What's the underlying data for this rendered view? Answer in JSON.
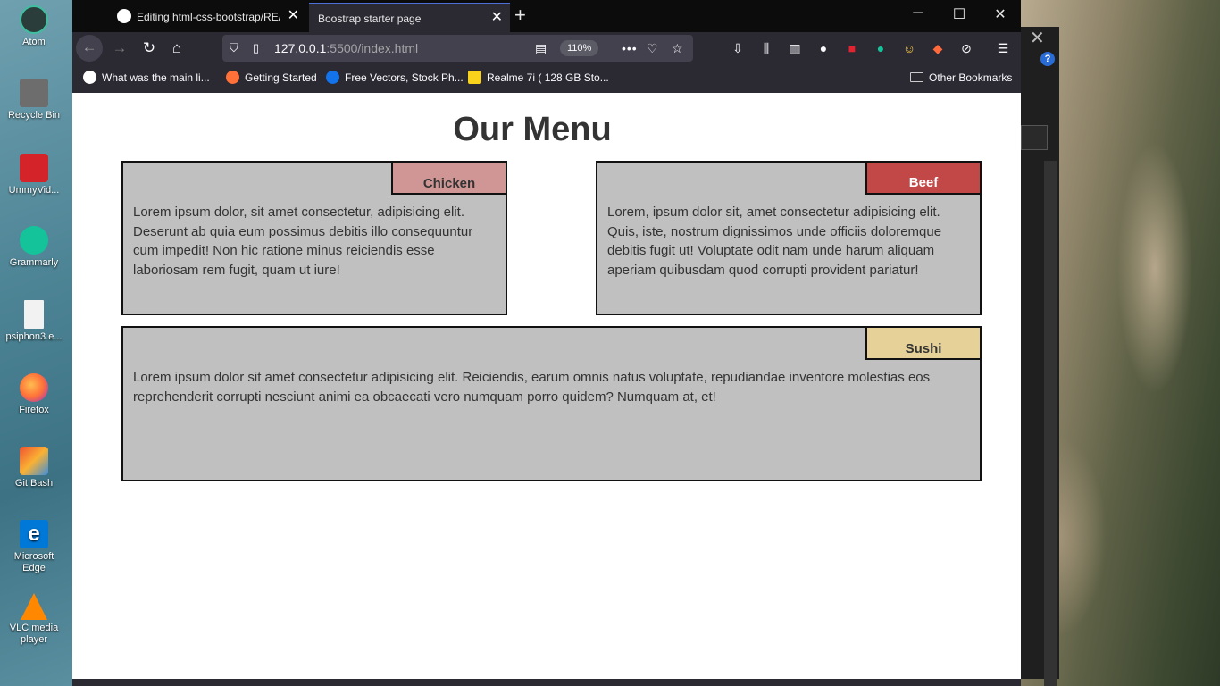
{
  "desktop": {
    "icons": [
      {
        "label": "Atom",
        "color": "#3fbf9f"
      },
      {
        "label": "Recycle Bin",
        "color": "#8a8a8a"
      },
      {
        "label": "UmmyVid...",
        "color": "#d4242a"
      },
      {
        "label": "Grammarly",
        "color": "#15c39a"
      },
      {
        "label": "psiphon3.e...",
        "color": "#f2f2f2"
      },
      {
        "label": "Firefox",
        "color": "#ff7139"
      },
      {
        "label": "Git Bash",
        "color": "#f05032"
      },
      {
        "label": "Microsoft Edge",
        "color": "#0078d7"
      },
      {
        "label": "VLC media player",
        "color": "#ff8800"
      }
    ]
  },
  "browser": {
    "tabs": [
      {
        "title": "Editing html-css-bootstrap/RE/",
        "icon": "github-icon",
        "active": false
      },
      {
        "title": "Boostrap starter page",
        "active": true
      }
    ],
    "url_host": "127.0.0.1",
    "url_path": ":5500/index.html",
    "zoom": "110%",
    "bookmarks": [
      {
        "label": "What was the main li...",
        "icon": "google-icon",
        "color": "#4285f4"
      },
      {
        "label": "Getting Started",
        "icon": "firefox-icon",
        "color": "#ff7139"
      },
      {
        "label": "Free Vectors, Stock Ph...",
        "icon": "freepik-icon",
        "color": "#1273eb"
      },
      {
        "label": "Realme 7i ( 128 GB Sto...",
        "icon": "flipkart-icon",
        "color": "#f8d21b"
      }
    ],
    "other_bookmarks": "Other Bookmarks"
  },
  "page": {
    "title": "Our Menu",
    "cards": [
      {
        "label": "Chicken",
        "color": "#d09696",
        "text": "Lorem ipsum dolor, sit amet consectetur, adipisicing elit. Deserunt ab quia eum possimus debitis illo consequuntur cum impedit! Non hic ratione minus reiciendis esse laboriosam rem fugit, quam ut iure!"
      },
      {
        "label": "Beef",
        "color": "#c24848",
        "text": "Lorem, ipsum dolor sit, amet consectetur adipisicing elit. Quis, iste, nostrum dignissimos unde officiis doloremque debitis fugit ut! Voluptate odit nam unde harum aliquam aperiam quibusdam quod corrupti provident pariatur!"
      },
      {
        "label": "Sushi",
        "color": "#e6d298",
        "text": "Lorem ipsum dolor sit amet consectetur adipisicing elit. Reiciendis, earum omnis natus voluptate, repudiandae inventore molestias eos reprehenderit corrupti nesciunt animi ea obcaecati vero numquam porro quidem? Numquam at, et!"
      }
    ]
  }
}
